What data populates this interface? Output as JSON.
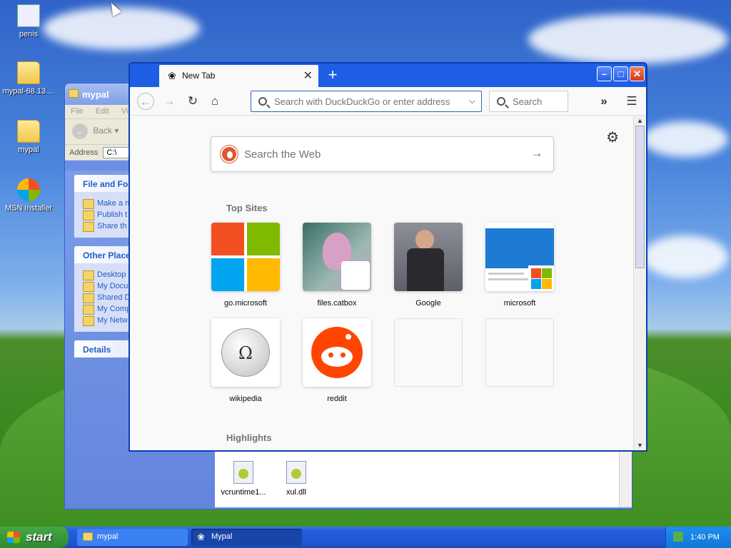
{
  "desktop": {
    "icons": [
      {
        "label": "penis",
        "icon": "image-file-icon"
      },
      {
        "label": "mypal-68.13....",
        "icon": "zip-file-icon"
      },
      {
        "label": "mypal",
        "icon": "folder-icon"
      },
      {
        "label": "MSN Installer",
        "icon": "msn-installer-icon"
      }
    ]
  },
  "explorer": {
    "title": "mypal",
    "menu": [
      "File",
      "Edit",
      "Vie"
    ],
    "back_label": "Back",
    "address_label": "Address",
    "address_value": "C:\\",
    "panels": [
      {
        "title": "File and Fol",
        "items": [
          "Make a n",
          "Publish t Web",
          "Share th"
        ]
      },
      {
        "title": "Other Place",
        "items": [
          "Desktop",
          "My Docu",
          "Shared D",
          "My Comp",
          "My Netw"
        ]
      },
      {
        "title": "Details",
        "items": []
      }
    ],
    "files": [
      {
        "name": "vcruntime1...",
        "icon": "dll-file-icon"
      },
      {
        "name": "xul.dll",
        "icon": "dll-file-icon"
      }
    ]
  },
  "browser": {
    "tab_title": "New Tab",
    "new_tab_symbol": "+",
    "url_placeholder": "Search with DuckDuckGo or enter address",
    "search_placeholder": "Search",
    "ddg_placeholder": "Search the Web",
    "top_sites_heading": "Top Sites",
    "highlights_heading": "Highlights",
    "top_sites": [
      {
        "label": "go.microsoft"
      },
      {
        "label": "files.catbox"
      },
      {
        "label": "Google"
      },
      {
        "label": "microsoft"
      },
      {
        "label": "wikipedia"
      },
      {
        "label": "reddit"
      },
      {
        "label": ""
      },
      {
        "label": ""
      }
    ],
    "colors": {
      "accent": "#1d5ee5",
      "reddit": "#ff4500",
      "ddg": "#de5833"
    }
  },
  "taskbar": {
    "start_label": "start",
    "tasks": [
      {
        "label": "mypal"
      },
      {
        "label": "Mypal"
      }
    ],
    "clock": "1:40 PM"
  }
}
